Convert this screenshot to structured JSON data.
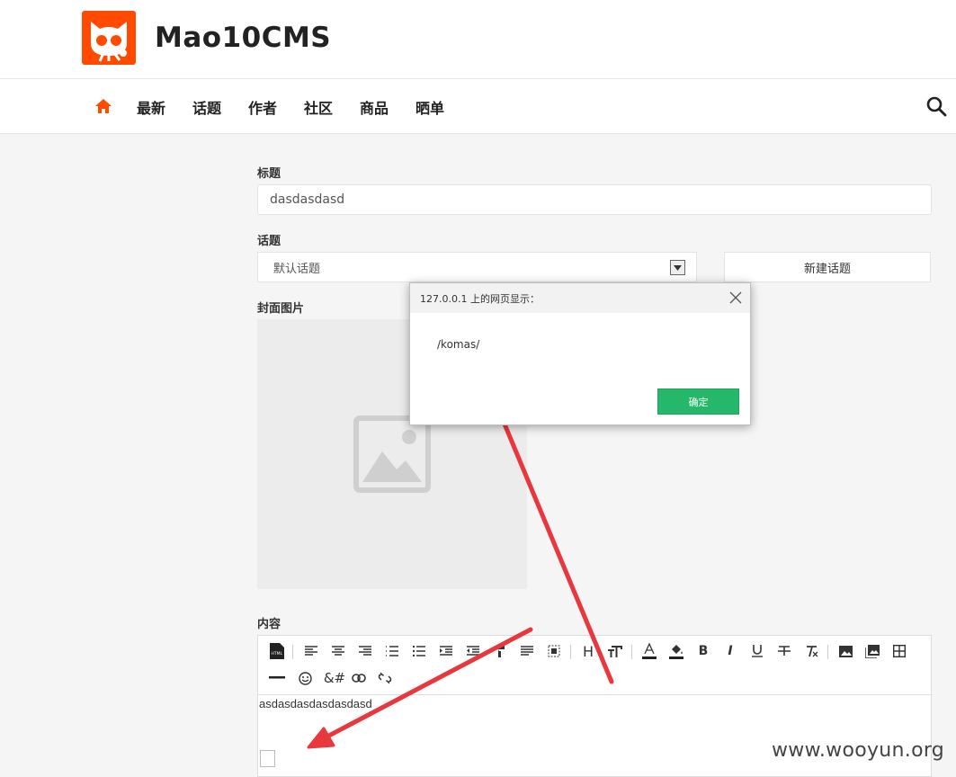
{
  "site": {
    "title": "Mao10CMS"
  },
  "nav": {
    "items": [
      "最新",
      "话题",
      "作者",
      "社区",
      "商品",
      "晒单"
    ]
  },
  "form": {
    "title_label": "标题",
    "title_value": "dasdasdasd",
    "topic_label": "话题",
    "topic_selected": "默认话题",
    "new_topic_button": "新建话题",
    "cover_label": "封面图片",
    "content_label": "内容"
  },
  "editor": {
    "content": "asdasdasdasdasdasd",
    "toolbar": {
      "html_icon": "HTML",
      "heading": "H",
      "entity": "&#"
    }
  },
  "dialog": {
    "title": "127.0.0.1 上的网页显示：",
    "message": "/komas/",
    "ok": "确定"
  },
  "watermark": "www.wooyun.org",
  "colors": {
    "accent": "#ff4a00",
    "ok_button": "#26b86a",
    "arrow": "#e8383d"
  }
}
